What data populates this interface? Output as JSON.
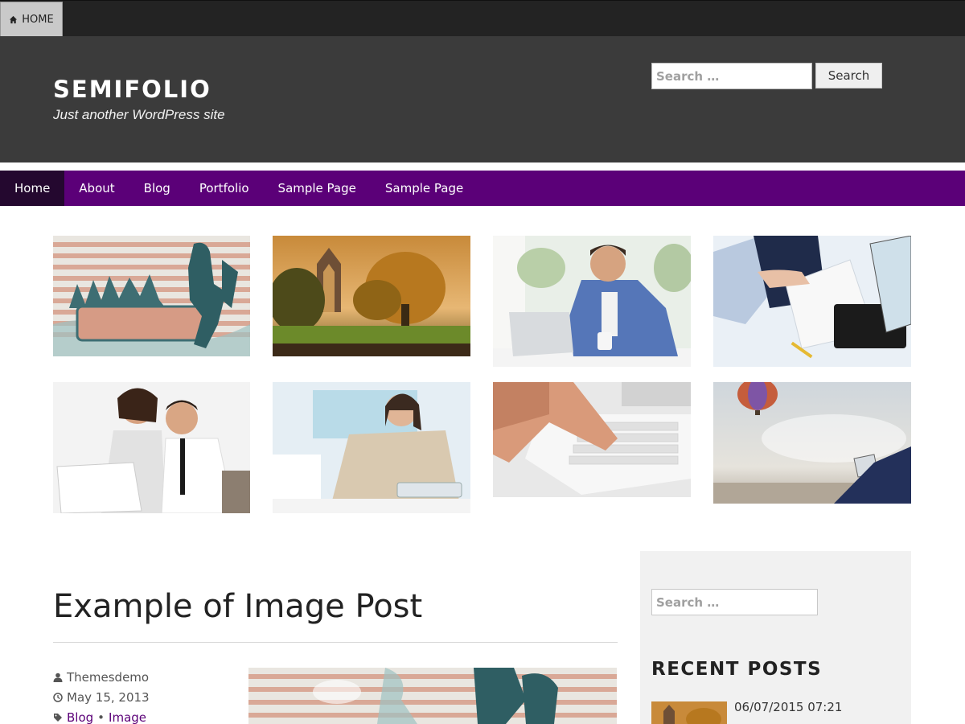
{
  "topbar": {
    "home_label": "HOME"
  },
  "header": {
    "site_title": "SEMIFOLIO",
    "tagline": "Just another WordPress site",
    "search_placeholder": "Search …",
    "search_button": "Search"
  },
  "nav": {
    "items": [
      {
        "label": "Home",
        "active": true
      },
      {
        "label": "About"
      },
      {
        "label": "Blog"
      },
      {
        "label": "Portfolio"
      },
      {
        "label": "Sample Page"
      },
      {
        "label": "Sample Page"
      }
    ]
  },
  "gallery": {
    "images": [
      {
        "name": "concert-silhouette-graphic"
      },
      {
        "name": "abbey-ruins-autumn"
      },
      {
        "name": "man-laptop-smiling"
      },
      {
        "name": "business-documents-keyboard"
      },
      {
        "name": "couple-laptop"
      },
      {
        "name": "woman-tablet-sofa"
      },
      {
        "name": "hand-laptop-keyboard"
      },
      {
        "name": "balloon-sky-laptop"
      }
    ]
  },
  "post": {
    "title": "Example of Image Post",
    "author": "Themesdemo",
    "date": "May 15, 2013",
    "categories": [
      "Blog",
      "Image"
    ],
    "category_separator": " •"
  },
  "sidebar": {
    "search_placeholder": "Search …",
    "recent_title": "RECENT POSTS",
    "recent_posts": [
      {
        "date": "06/07/2015 07:21"
      }
    ]
  },
  "colors": {
    "nav_bg": "#5b0078",
    "nav_active": "#24082f",
    "header_bg": "#3b3b3b",
    "topbar_bg": "#232323",
    "link": "#5b0078"
  }
}
